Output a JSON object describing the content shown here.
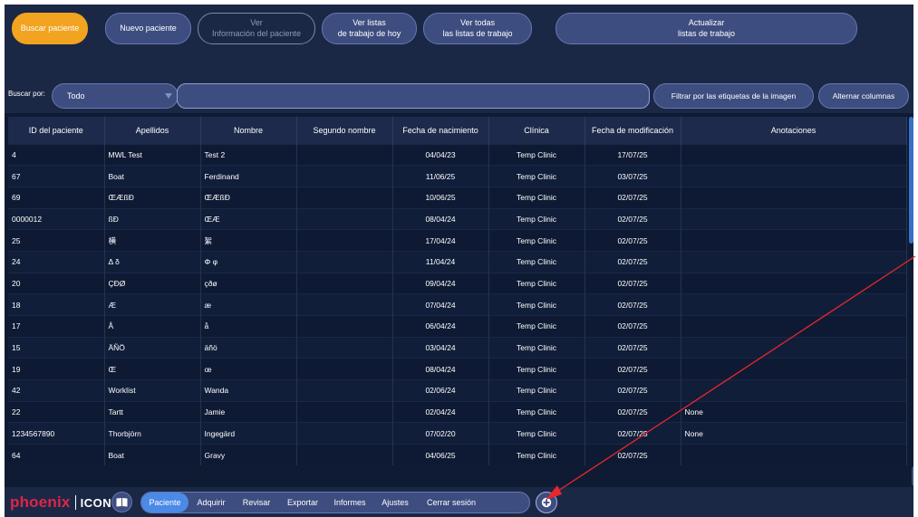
{
  "toolbar": {
    "search_patient": "Buscar paciente",
    "new_patient": "Nuevo paciente",
    "view_info_line1": "Ver",
    "view_info_line2": "Información del paciente",
    "today_worklists_line1": "Ver listas",
    "today_worklists_line2": "de trabajo de hoy",
    "all_worklists_line1": "Ver todas",
    "all_worklists_line2": "las listas de trabajo",
    "refresh_line1": "Actualizar",
    "refresh_line2": "listas de trabajo"
  },
  "search": {
    "label": "Buscar por:",
    "field_value": "Todo",
    "query_value": "",
    "filter_tags_button": "Filtrar por las etiquetas de la imagen",
    "toggle_columns_button": "Alternar columnas"
  },
  "table": {
    "headers": [
      "ID del paciente",
      "Apellidos",
      "Nombre",
      "Segundo nombre",
      "Fecha de nacimiento",
      "Clínica",
      "Fecha de modificación",
      "Anotaciones"
    ],
    "rows": [
      [
        "4",
        "MWL Test",
        "Test 2",
        "",
        "04/04/23",
        "Temp Clinic",
        "17/07/25",
        ""
      ],
      [
        "67",
        "Boat",
        "Ferdinand",
        "",
        "11/06/25",
        "Temp Clinic",
        "03/07/25",
        ""
      ],
      [
        "69",
        "ŒÆßÐ",
        "ŒÆßÐ",
        "",
        "10/06/25",
        "Temp Clinic",
        "02/07/25",
        ""
      ],
      [
        "0000012",
        "ßÐ",
        "ŒÆ",
        "",
        "08/04/24",
        "Temp Clinic",
        "02/07/25",
        ""
      ],
      [
        "25",
        "横",
        "絮",
        "",
        "17/04/24",
        "Temp Clinic",
        "02/07/25",
        ""
      ],
      [
        "24",
        "Δ δ",
        "Φ φ",
        "",
        "11/04/24",
        "Temp Clinic",
        "02/07/25",
        ""
      ],
      [
        "20",
        "ÇÐØ",
        "çðø",
        "",
        "09/04/24",
        "Temp Clinic",
        "02/07/25",
        ""
      ],
      [
        "18",
        "Æ",
        "æ",
        "",
        "07/04/24",
        "Temp Clinic",
        "02/07/25",
        ""
      ],
      [
        "17",
        "Å",
        "å",
        "",
        "06/04/24",
        "Temp Clinic",
        "02/07/25",
        ""
      ],
      [
        "15",
        "ÄÑÖ",
        "äñö",
        "",
        "03/04/24",
        "Temp Clinic",
        "02/07/25",
        ""
      ],
      [
        "19",
        "Œ",
        "œ",
        "",
        "08/04/24",
        "Temp Clinic",
        "02/07/25",
        ""
      ],
      [
        "42",
        "Worklist",
        "Wanda",
        "",
        "02/06/24",
        "Temp Clinic",
        "02/07/25",
        ""
      ],
      [
        "22",
        "Tartt",
        "Jamie",
        "",
        "02/04/24",
        "Temp Clinic",
        "02/07/25",
        "None"
      ],
      [
        "1234567890",
        "Thorbjörn",
        "Ingegärd",
        "",
        "07/02/20",
        "Temp Clinic",
        "02/07/25",
        "None"
      ],
      [
        "64",
        "Boat",
        "Gravy",
        "",
        "04/06/25",
        "Temp Clinic",
        "02/07/25",
        ""
      ]
    ]
  },
  "bottom": {
    "logo_main": "phoenix",
    "logo_sub": "ICON",
    "tabs": [
      "Paciente",
      "Adquirir",
      "Revisar",
      "Exportar",
      "Informes",
      "Ajustes",
      "Cerrar sesión"
    ],
    "active_tab": "Paciente"
  },
  "colors": {
    "accent": "#f2a31f",
    "active_tab": "#4b8ae6",
    "panel": "#1b2845",
    "logo_red": "#e0244a",
    "annotation_arrow": "#e8262d"
  },
  "icons": {
    "book": "book-icon",
    "plus": "plus-icon",
    "caret": "caret-down-icon"
  }
}
